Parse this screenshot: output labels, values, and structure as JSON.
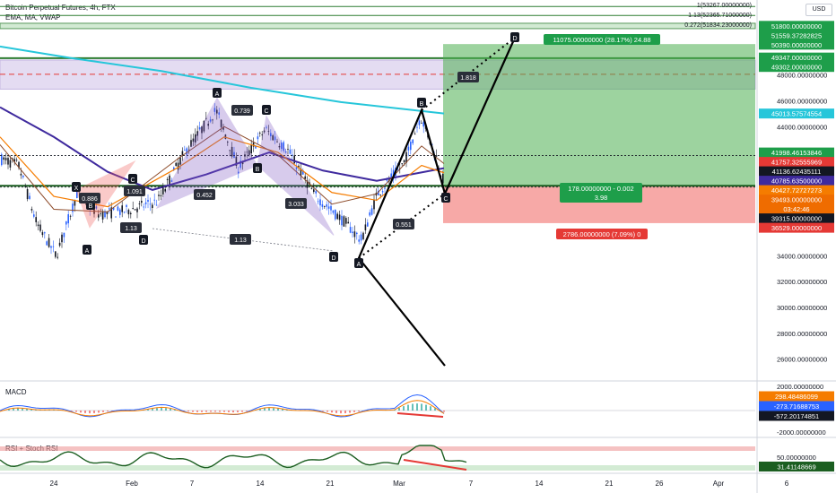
{
  "header": {
    "title": "Bitcoin Perpetual Futures, 4h, FTX",
    "indicators": "EMA, MA, VWAP",
    "currency": "USD"
  },
  "fib_labels": [
    "1(53267.00000000)",
    "1.13(52365.71000000)",
    "0.272(51834.23000000)"
  ],
  "price_labels": [
    {
      "value": "51800.00000000",
      "price": 51800,
      "bg": "#1e9e4a",
      "fg": "#ffffff"
    },
    {
      "value": "51559.37282825",
      "price": 51559,
      "bg": "#1e9e4a",
      "fg": "#ffffff"
    },
    {
      "value": "50390.00000000",
      "price": 50390,
      "bg": "#1e9e4a",
      "fg": "#ffffff"
    },
    {
      "value": "49347.00000000",
      "price": 49347,
      "bg": "#1e9e4a",
      "fg": "#ffffff"
    },
    {
      "value": "49302.00000000",
      "price": 49302,
      "bg": "#1e9e4a",
      "fg": "#ffffff"
    },
    {
      "value": "45013.57574554",
      "price": 45013,
      "bg": "#26c6da",
      "fg": "#ffffff"
    },
    {
      "value": "41998.46153846",
      "price": 41998,
      "bg": "#1e9e4a",
      "fg": "#ffffff"
    },
    {
      "value": "41757.32555969",
      "price": 41757,
      "bg": "#e53935",
      "fg": "#ffffff"
    },
    {
      "value": "41136.62435111",
      "price": 41136,
      "bg": "#131722",
      "fg": "#ffffff"
    },
    {
      "value": "40785.63500000",
      "price": 40785,
      "bg": "#3f2a9e",
      "fg": "#ffffff"
    },
    {
      "value": "40427.72727273",
      "price": 40427,
      "bg": "#f57c00",
      "fg": "#ffffff"
    },
    {
      "value": "39493.00000000",
      "price": 39493,
      "bg": "#ef6c00",
      "fg": "#ffffff"
    },
    {
      "value": "03:42:46",
      "price": 39020,
      "bg": "#ef6c00",
      "fg": "#ffffff"
    },
    {
      "value": "39315.00000000",
      "price": 38555,
      "bg": "#131722",
      "fg": "#ffffff"
    },
    {
      "value": "36529.00000000",
      "price": 36529,
      "bg": "#e53935",
      "fg": "#ffffff"
    }
  ],
  "y_ticks": [
    "48000.00000000",
    "46000.00000000",
    "44000.00000000",
    "34000.00000000",
    "32000.00000000",
    "30000.00000000",
    "28000.00000000",
    "26000.00000000"
  ],
  "x_ticks": [
    "24",
    "Feb",
    "7",
    "14",
    "21",
    "Mar",
    "7",
    "14",
    "21",
    "26",
    "Apr",
    "6"
  ],
  "position": {
    "target_text": "11075.00000000 (28.17%) 24.88",
    "mid_line1": "178.00000000 - 0.002",
    "mid_line2": "3.98",
    "stop_text": "2786.00000000 (7.09%) 0"
  },
  "pattern_labels": [
    "A",
    "B",
    "C",
    "D",
    "X",
    "A",
    "B",
    "C",
    "D"
  ],
  "ratio_labels": [
    "0.739",
    "0.452",
    "3.033",
    "1.13",
    "0.551",
    "1.818",
    "0.886",
    "1.091",
    "1.13"
  ],
  "macd": {
    "title": "MACD",
    "ticks": [
      "2000.00000000",
      "-2000.00000000"
    ],
    "labels": [
      {
        "value": "298.48486099",
        "bg": "#f57c00"
      },
      {
        "value": "-273.71688753",
        "bg": "#2962ff"
      },
      {
        "value": "-572.20174851",
        "bg": "#131722"
      }
    ]
  },
  "rsi": {
    "title": "RSI + Stoch RSI",
    "ticks": [
      "50.00000000"
    ],
    "label": {
      "value": "31.41148669",
      "bg": "#1b5e20"
    }
  },
  "chart_data": {
    "type": "candlestick",
    "title": "Bitcoin Perpetual Futures, 4h, FTX",
    "ylim": [
      24800,
      53800
    ],
    "harmonic_pattern": {
      "points": [
        {
          "label": "X",
          "price": 46800
        },
        {
          "label": "A",
          "price": 34400
        },
        {
          "label": "B",
          "price": 45300
        },
        {
          "label": "C",
          "price": 39400
        },
        {
          "label": "D",
          "price": 52000
        }
      ],
      "ratios": [
        "0.551",
        "1.818"
      ]
    },
    "long_position": {
      "entry": 39420,
      "target": 50390,
      "stop": 36529
    },
    "zones": [
      {
        "from": 46900,
        "to": 49150
      },
      {
        "from": 49302,
        "to": 49347
      }
    ],
    "grid": false
  }
}
